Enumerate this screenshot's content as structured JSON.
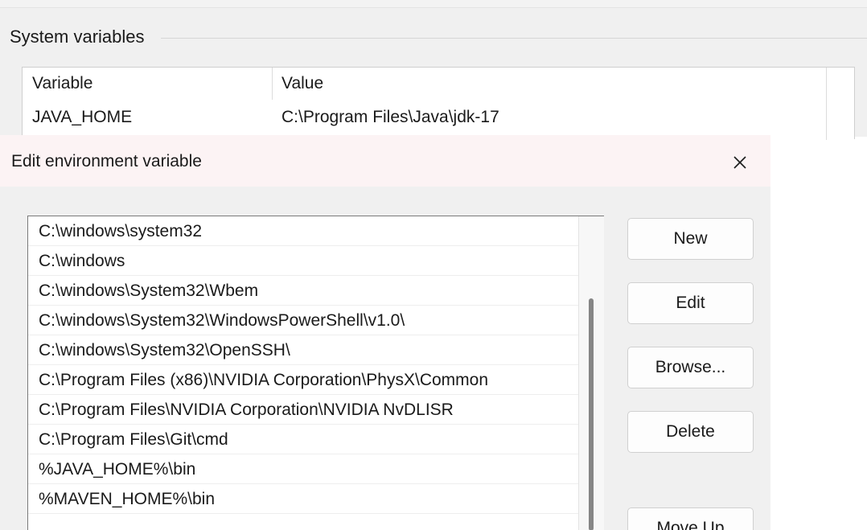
{
  "background_window": {
    "group_label": "System variables",
    "table": {
      "columns": [
        "Variable",
        "Value"
      ],
      "rows": [
        {
          "variable": "JAVA_HOME",
          "value": "C:\\Program Files\\Java\\jdk-17"
        }
      ]
    }
  },
  "dialog": {
    "title": "Edit environment variable",
    "close_icon": "close-icon",
    "paths": [
      "C:\\windows\\system32",
      "C:\\windows",
      "C:\\windows\\System32\\Wbem",
      "C:\\windows\\System32\\WindowsPowerShell\\v1.0\\",
      "C:\\windows\\System32\\OpenSSH\\",
      "C:\\Program Files (x86)\\NVIDIA Corporation\\PhysX\\Common",
      "C:\\Program Files\\NVIDIA Corporation\\NVIDIA NvDLISR",
      "C:\\Program Files\\Git\\cmd",
      "%JAVA_HOME%\\bin",
      "%MAVEN_HOME%\\bin"
    ],
    "buttons": {
      "new": "New",
      "edit": "Edit",
      "browse": "Browse...",
      "delete": "Delete",
      "move_up": "Move Up"
    }
  },
  "colors": {
    "dialog_bg": "#f0f0f0",
    "titlebar_bg": "#fcf3f4",
    "list_border": "#7a7a7a"
  }
}
